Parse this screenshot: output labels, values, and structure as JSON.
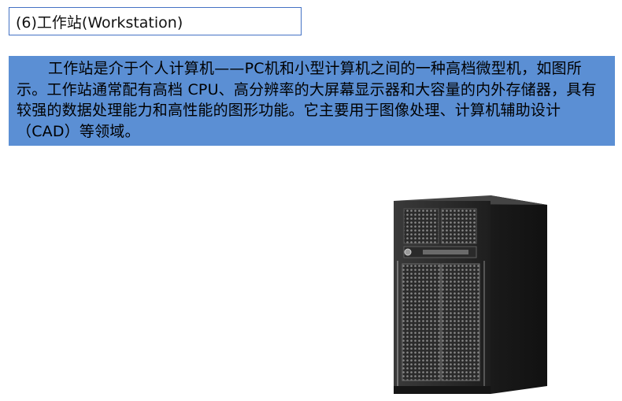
{
  "slide": {
    "title": "(6)工作站(Workstation)",
    "paragraph": "工作站是介于个人计算机——PC机和小型计算机之间的一种高档微型机，如图所示。工作站通常配有高档 CPU、高分辨率的大屏幕显示器和大容量的内外存储器，具有较强的数据处理能力和高性能的图形功能。它主要用于图像处理、计算机辅助设计（CAD）等领域。",
    "paragraph_bg": "#5b8fd4"
  },
  "image": {
    "icon": "workstation-tower-icon"
  }
}
